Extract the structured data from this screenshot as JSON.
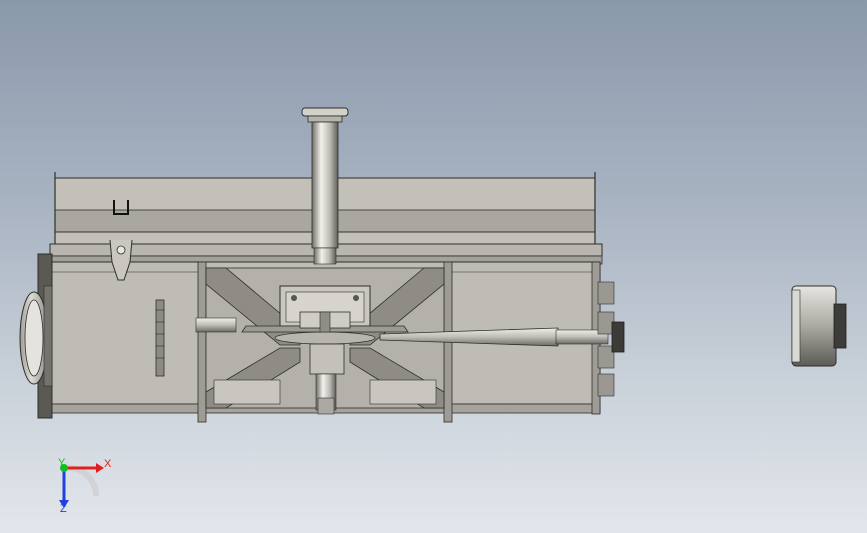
{
  "viewport": {
    "background_top": "#8a98ab",
    "background_bottom": "#e3e7ec"
  },
  "model": {
    "part_color": "#bfbdb5",
    "part_dark": "#6b6a64",
    "edge_color": "#2e2e2a"
  },
  "triad": {
    "x_label": "X",
    "y_label": "Y",
    "z_label": "Z",
    "x_color": "#e02020",
    "y_color": "#10c020",
    "z_color": "#2040e0"
  }
}
